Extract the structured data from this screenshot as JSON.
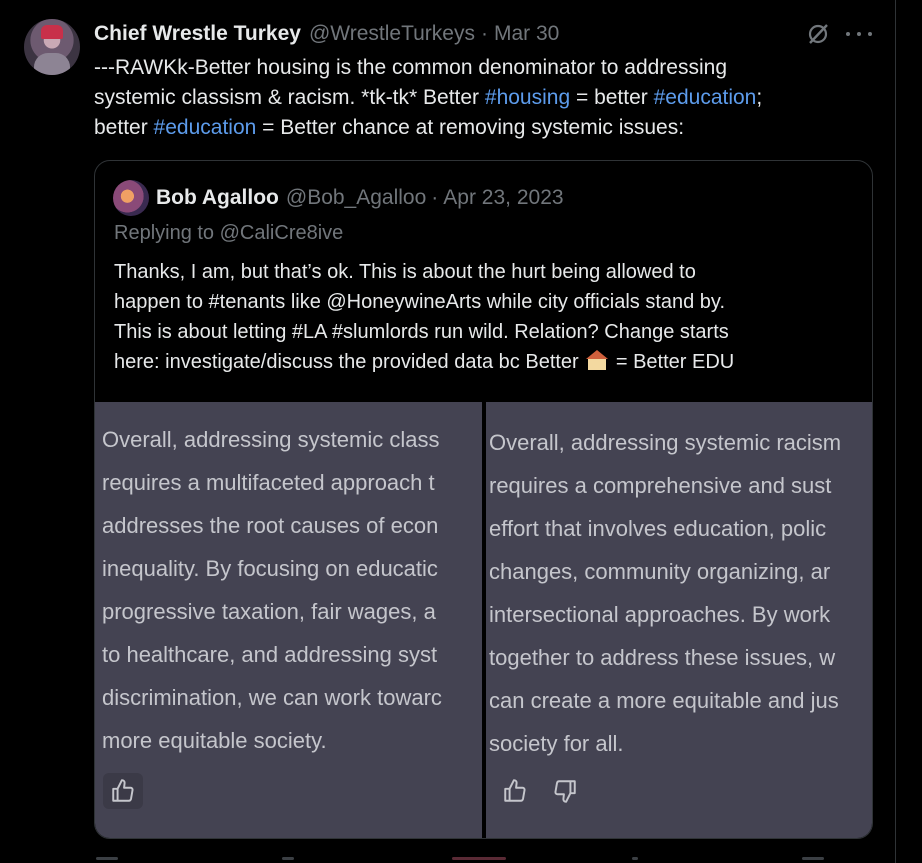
{
  "tweet": {
    "author_name": "Chief Wrestle Turkey",
    "handle": "@WrestleTurkeys",
    "separator": "·",
    "date": "Mar 30",
    "line1": "---RAWKk-Better housing is the common denominator to addressing",
    "line2_a": "systemic classism & racism. *tk-tk* Better ",
    "line2_tag1": "#housing",
    "line2_b": " = better ",
    "line2_tag2": "#education",
    "line2_c": ";",
    "line3_a": "better ",
    "line3_tag": "#education",
    "line3_b": " = Better chance at removing systemic issues:"
  },
  "quote": {
    "author_name": "Bob Agalloo",
    "handle": "@Bob_Agalloo",
    "separator": "·",
    "date": "Apr 23, 2023",
    "replying": "Replying to @CaliCre8ive",
    "line1": "Thanks, I am, but that’s ok. This is about the hurt being allowed to",
    "line2": "happen to #tenants like @HoneywineArts while city officials stand by.",
    "line3": "This is about letting #LA #slumlords run wild. Relation? Change starts",
    "line4_a": "here: investigate/discuss the provided data bc Better ",
    "line4_b": " = Better EDU"
  },
  "media": {
    "left_lines": [
      "Overall, addressing systemic class",
      "requires a multifaceted approach t",
      "addresses the root causes of econ",
      "inequality. By focusing on educatic",
      "progressive taxation, fair wages, a",
      "to healthcare, and addressing syst",
      "discrimination, we can work towarc",
      "more equitable society."
    ],
    "right_lines": [
      "Overall, addressing systemic racism",
      "requires a comprehensive and sust",
      "effort that involves education, polic",
      "changes, community organizing, ar",
      "intersectional approaches. By work",
      "together to address these issues, w",
      "can create a more equitable and jus",
      "society for all."
    ]
  },
  "icons": {
    "grok": "grok-icon",
    "more": "more-icon",
    "thumbs_up": "thumbs-up-icon",
    "thumbs_down": "thumbs-down-icon",
    "house_emoji": "house-icon"
  },
  "colors": {
    "background": "#000000",
    "text": "#e7e9ea",
    "muted": "#71767b",
    "hashtag": "#5d9cec",
    "panel": "#444352"
  }
}
